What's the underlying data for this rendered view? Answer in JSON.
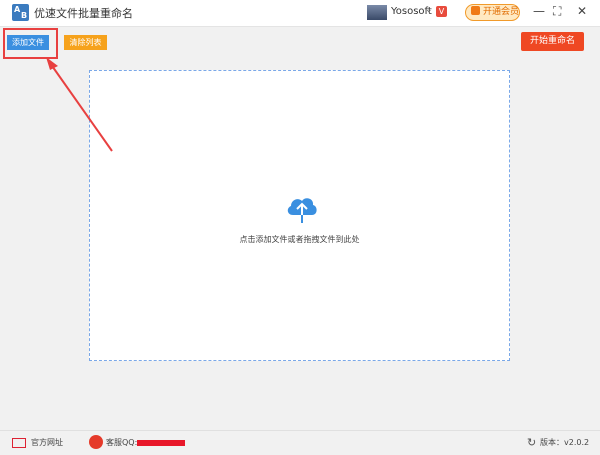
{
  "window": {
    "title": "优速文件批量重命名",
    "icon_text": "AB",
    "user_name": "Yososoft",
    "vip_button": "开通会员",
    "controls": [
      "—",
      "⛶",
      "✕"
    ]
  },
  "toolbar": {
    "add_files": "添加文件",
    "clear_list": "清除列表",
    "start_rename": "开始重命名"
  },
  "dropzone": {
    "hint": "点击添加文件或者拖拽文件到此处"
  },
  "footer": {
    "website": "官方网址",
    "support": "客服QQ:",
    "version": "版本：v2.0.2"
  },
  "colors": {
    "accent_blue": "#3a8fe0",
    "clear_orange": "#f6a21c",
    "start_red": "#ef4823",
    "highlight_red": "#e84040"
  }
}
